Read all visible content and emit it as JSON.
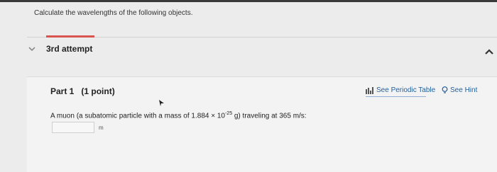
{
  "header": {
    "prompt": "Calculate the wavelengths of the following objects."
  },
  "attempt": {
    "label": "3rd attempt"
  },
  "part": {
    "title": "Part 1",
    "points": "(1 point)",
    "links": {
      "periodic_table": "See Periodic Table",
      "hint": "See Hint"
    }
  },
  "question": {
    "text_before": "A muon (a subatomic particle with a mass of 1.884 × 10",
    "exponent": "-25",
    "text_after": " g) traveling at 365  m/s:"
  },
  "answer": {
    "value": "",
    "placeholder": "",
    "unit": "m"
  },
  "colors": {
    "accent_red": "#d9534f",
    "link_blue": "#1f5f9e"
  }
}
